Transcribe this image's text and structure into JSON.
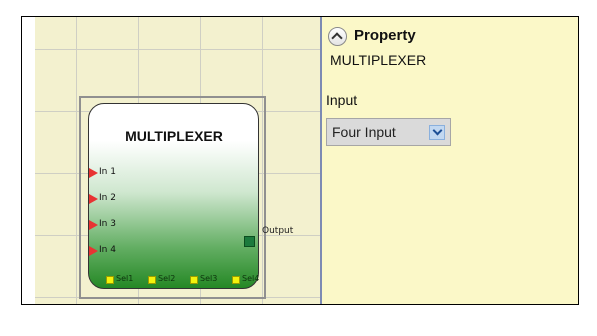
{
  "property_panel": {
    "header": "Property",
    "selected_name": "MULTIPLEXER",
    "input_label": "Input",
    "input_value": "Four Input",
    "collapse_icon": "chevron-up-icon",
    "dropdown_icon": "chevron-down-icon"
  },
  "block": {
    "title": "MULTIPLEXER",
    "inputs": [
      "In 1",
      "In 2",
      "In 3",
      "In 4"
    ],
    "output": "Output",
    "selectors": [
      "Sel1",
      "Sel2",
      "Sel3",
      "Sel4"
    ]
  },
  "colors": {
    "panel_bg": "#fbf8c8",
    "canvas_bg": "#f3f1cf",
    "input_port": "#e83333",
    "output_port": "#1c7a3d",
    "selector_port": "#f3f30d"
  }
}
